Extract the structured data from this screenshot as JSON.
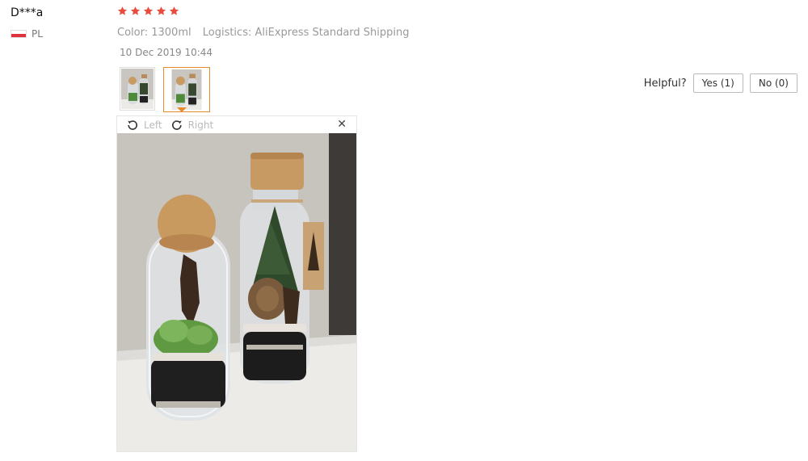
{
  "review": {
    "user_name": "D***a",
    "country_code": "PL",
    "rating_stars": 5,
    "attributes": {
      "color_label": "Color:",
      "color_value": "1300ml",
      "logistics_label": "Logistics:",
      "logistics_value": "AliExpress Standard Shipping"
    },
    "date": "10 Dec 2019 10:44"
  },
  "helpful": {
    "label": "Helpful?",
    "yes_label": "Yes (1)",
    "no_label": "No (0)"
  },
  "viewer": {
    "rotate_left_label": "Left",
    "rotate_right_label": "Right",
    "close_icon": "close-icon",
    "selected_thumb": 2
  },
  "colors": {
    "star": "#e74c3c",
    "accent": "#e78a2e",
    "flag_red": "#e0313f"
  },
  "icons": {
    "star": "star-icon",
    "flag": "poland-flag-icon",
    "rotate_left": "rotate-left-icon",
    "rotate_right": "rotate-right-icon"
  }
}
